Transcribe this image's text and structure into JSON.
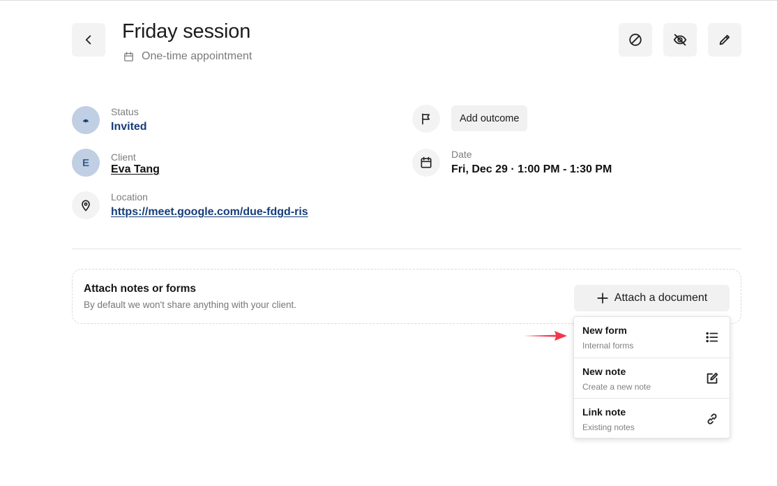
{
  "header": {
    "title": "Friday session",
    "subtitle": "One-time appointment"
  },
  "actions": {
    "back": "back",
    "cancel": "cancel",
    "hide": "hide",
    "edit": "edit"
  },
  "details": {
    "status_label": "Status",
    "status_value": "Invited",
    "client_label": "Client",
    "client_initial": "E",
    "client_value": "Eva Tang",
    "location_label": "Location",
    "location_value": "https://meet.google.com/due-fdgd-ris",
    "outcome_button": "Add outcome",
    "date_label": "Date",
    "date_value": "Fri, Dec 29 · 1:00 PM - 1:30 PM"
  },
  "attach": {
    "title": "Attach notes or forms",
    "subtitle": "By default we won't share anything with your client.",
    "button_label": "Attach a document"
  },
  "menu": {
    "items": [
      {
        "title": "New form",
        "subtitle": "Internal forms",
        "icon": "list-icon"
      },
      {
        "title": "New note",
        "subtitle": "Create a new note",
        "icon": "edit-note-icon"
      },
      {
        "title": "Link note",
        "subtitle": "Existing notes",
        "icon": "link-icon"
      }
    ]
  },
  "colors": {
    "link": "#163d7a",
    "avatar_bg": "#c0cfe3",
    "arrow": "#f2364c",
    "button_bg": "#f1f1f1"
  }
}
